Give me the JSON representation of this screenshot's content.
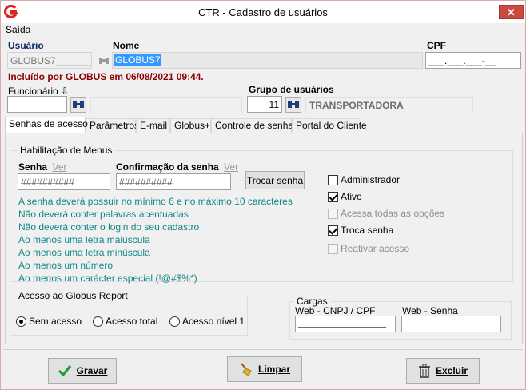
{
  "window": {
    "title": "CTR - Cadastro de usuários",
    "close_glyph": "✕"
  },
  "menu": {
    "saida": "Saída"
  },
  "header": {
    "usuario_label": "Usuário",
    "usuario_value": "GLOBUS7_______",
    "nome_label": "Nome",
    "nome_value": "GLOBUS7",
    "cpf_label": "CPF",
    "cpf_value": "___.___.___-__",
    "included_text": "Incluído por GLOBUS em 06/08/2021 09:44.",
    "funcionario_label": "Funcionário ⇩",
    "funcionario_value": "",
    "funcionario_name": "",
    "grupo_label": "Grupo de usuários",
    "grupo_code": "11",
    "grupo_name": "TRANSPORTADORA"
  },
  "tabs": [
    "Senhas de acesso",
    "Parâmetros",
    "E-mail",
    "Globus+",
    "Controle de senhas",
    "Portal do Cliente"
  ],
  "habilitacao": {
    "title": "Habilitação de Menus",
    "senha_label": "Senha",
    "ver_label": "Ver",
    "confirm_label": "Confirmação da senha",
    "ver2_label": "Ver",
    "senha_value": "##########",
    "confirm_value": "##########",
    "trocar_button": "Trocar senha",
    "rules": [
      "A senha deverá possuir no mínimo 6 e no máximo 10 caracteres",
      "Não deverá conter palavras acentuadas",
      "Não deverá conter o login do seu cadastro",
      "Ao menos uma letra maiúscula",
      "Ao menos uma letra minúscula",
      "Ao menos um número",
      "Ao menos um carácter especial (!@#$%*)"
    ],
    "checkboxes": [
      {
        "label": "Administrador",
        "checked": false,
        "enabled": true
      },
      {
        "label": "Ativo",
        "checked": true,
        "enabled": true
      },
      {
        "label": "Acessa todas as opções",
        "checked": false,
        "enabled": false
      },
      {
        "label": "Troca senha",
        "checked": true,
        "enabled": true
      },
      {
        "label": "Reativar acesso",
        "checked": false,
        "enabled": false
      }
    ]
  },
  "acesso": {
    "title": "Acesso ao Globus Report",
    "options": [
      {
        "label": "Sem acesso",
        "selected": true
      },
      {
        "label": "Acesso total",
        "selected": false
      },
      {
        "label": "Acesso nível 1",
        "selected": false
      }
    ]
  },
  "cargas": {
    "title": "Cargas",
    "cnpj_label": "Web - CNPJ / CPF",
    "cnpj_value": "__________________",
    "senha_label": "Web - Senha",
    "senha_value": ""
  },
  "buttons": {
    "gravar": "Gravar",
    "limpar": "Limpar",
    "excluir": "Excluir"
  },
  "colors": {
    "accent_blue": "#0a246a",
    "teal": "#138787",
    "red_text": "#8b0000",
    "selection": "#3399ff",
    "logo_red": "#d9251d"
  }
}
